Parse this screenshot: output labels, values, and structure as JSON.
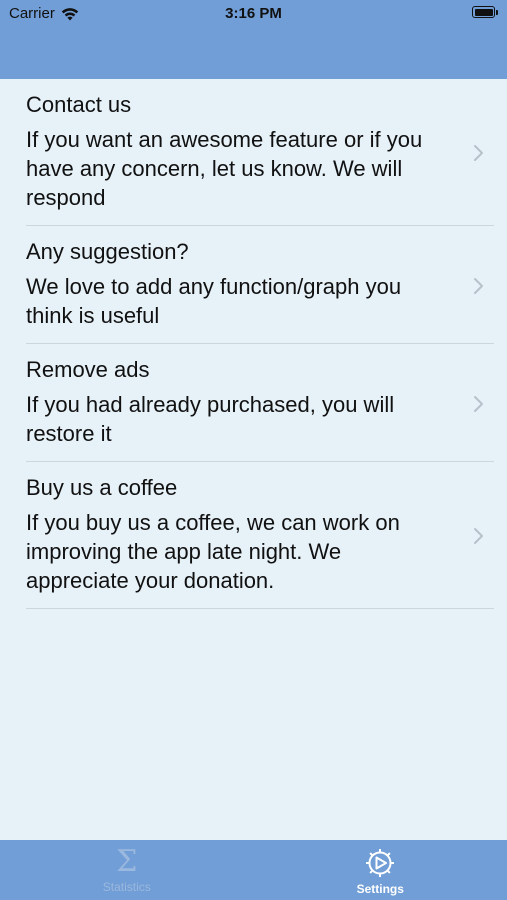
{
  "status_bar": {
    "carrier": "Carrier",
    "time": "3:16 PM"
  },
  "list": {
    "items": [
      {
        "title": "Contact us",
        "description": "If you want an awesome feature or if you have any concern, let us know. We will respond"
      },
      {
        "title": "Any suggestion?",
        "description": "We love to add any function/graph you think is useful"
      },
      {
        "title": "Remove ads",
        "description": "If you had already purchased, you will restore it"
      },
      {
        "title": "Buy us a coffee",
        "description": "If you buy us a coffee, we can work on improving the app late night. We appreciate your donation."
      }
    ]
  },
  "tabbar": {
    "tabs": [
      {
        "label": "Statistics",
        "icon": "sigma-icon",
        "selected": false
      },
      {
        "label": "Settings",
        "icon": "gear-icon",
        "selected": true
      }
    ]
  },
  "colors": {
    "header": "#719ed6",
    "background": "#e6f1f8",
    "tab_inactive": "#9bb8df",
    "tab_active": "#ffffff"
  }
}
